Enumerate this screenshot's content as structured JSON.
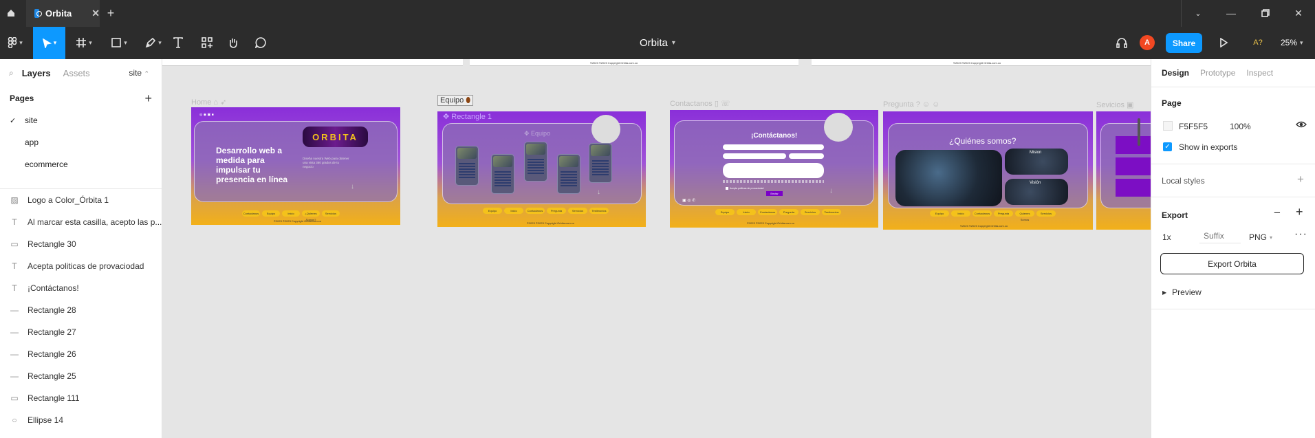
{
  "app": {
    "tab_title": "Orbita",
    "file_name": "Orbita",
    "user_initial": "A",
    "share_label": "Share",
    "a11y_label": "A?",
    "zoom": "25%"
  },
  "left_panel": {
    "tabs": [
      "Layers",
      "Assets"
    ],
    "page_selector": "site",
    "pages_title": "Pages",
    "pages": [
      {
        "name": "site",
        "active": true
      },
      {
        "name": "app",
        "active": false
      },
      {
        "name": "ecommerce",
        "active": false
      }
    ],
    "layers": [
      {
        "icon": "image-icon",
        "name": "Logo a Color_Órbita 1"
      },
      {
        "icon": "text-icon",
        "name": "Al marcar esta casilla, acepto las p..."
      },
      {
        "icon": "rectangle-icon",
        "name": "Rectangle 30"
      },
      {
        "icon": "text-icon",
        "name": "Acepta politicas de provaciodad"
      },
      {
        "icon": "text-icon",
        "name": "¡Contáctanos!"
      },
      {
        "icon": "line-icon",
        "name": "Rectangle 28"
      },
      {
        "icon": "line-icon",
        "name": "Rectangle 27"
      },
      {
        "icon": "line-icon",
        "name": "Rectangle 26"
      },
      {
        "icon": "line-icon",
        "name": "Rectangle 25"
      },
      {
        "icon": "rectangle-icon",
        "name": "Rectangle 111"
      },
      {
        "icon": "ellipse-icon",
        "name": "Ellipse 14"
      }
    ]
  },
  "right_panel": {
    "tabs": [
      "Design",
      "Prototype",
      "Inspect"
    ],
    "page_title": "Page",
    "page_color": "F5F5F5",
    "page_opacity": "100%",
    "show_in_exports": "Show in exports",
    "local_styles": "Local styles",
    "export_title": "Export",
    "export_scale": "1x",
    "export_suffix_placeholder": "Suffix",
    "export_format": "PNG",
    "export_button": "Export Orbita",
    "preview": "Preview"
  },
  "canvas": {
    "frames": [
      {
        "label": "Home"
      },
      {
        "label": "Equipo"
      },
      {
        "label": "Contactanos"
      },
      {
        "label": "Pregunta"
      },
      {
        "label": "Sevicios"
      }
    ],
    "selected_layer": "Rectangle 1",
    "home": {
      "headline": "Desarrollo web a medida para impulsar tu presencia en línea",
      "logo_text": "ORBITA",
      "paragraph": "Diseña nuestra Web para obtener una vista 360 grados de tu negocio",
      "nav": [
        "Contactanos",
        "Equipo",
        "Inicio",
        "¿Quienes Somos?",
        "Servicios"
      ],
      "footer": "©2023 ©2023 Copyright Orbita.com.co"
    },
    "equipo": {
      "title": "Equipo",
      "nav": [
        "Equipo",
        "Inicio",
        "Contactanos",
        "Pregunta",
        "Servicios",
        "Testimonios"
      ],
      "footer": "©2023 ©2023 Copyright Orbita.com.co"
    },
    "contactanos": {
      "title": "¡Contáctanos!",
      "submit": "Enviar",
      "checkbox": "Acepta politicas de provaciodad",
      "nav": [
        "Equipo",
        "Inicio",
        "Contactanos",
        "Pregunta",
        "Servicios",
        "Testimonios"
      ],
      "footer": "©2023 ©2023 Copyright Orbita.com.co"
    },
    "pregunta": {
      "title": "¿Quiénes somos?",
      "mision": "Mision",
      "vision": "Visión",
      "nav": [
        "Equipo",
        "Inicio",
        "Contactanos",
        "Pregunta",
        "Quienes Somos",
        "Servicios"
      ],
      "footer": "©2023 ©2023 Copyright Orbita.com.co"
    },
    "top_footer": "©2023 ©2023 Copyright Orbita.com.co"
  },
  "colors": {
    "accent": "#0d99ff",
    "avatar": "#f24822",
    "toolbar": "#2c2c2c"
  }
}
